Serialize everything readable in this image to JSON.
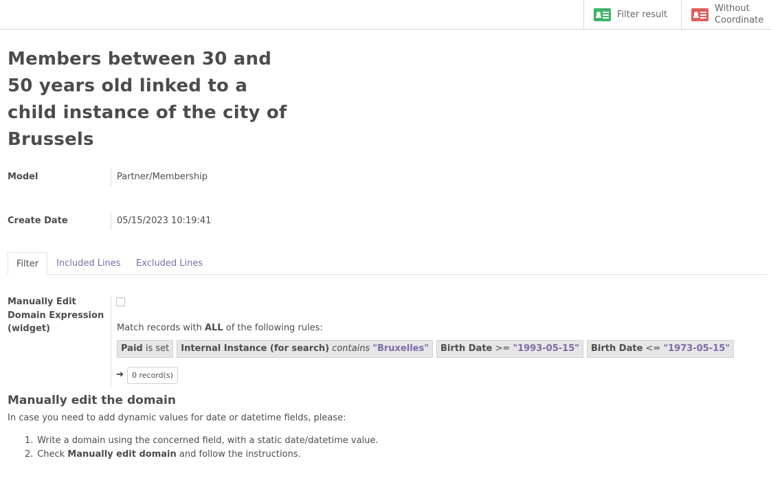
{
  "buttons": {
    "filter_result": "Filter result",
    "without_coordinate": "Without Coordinate"
  },
  "title": "Members between 30 and 50 years old linked to a child instance of the city of Brussels",
  "fields": {
    "model_label": "Model",
    "model_value": "Partner/Membership",
    "create_date_label": "Create Date",
    "create_date_value": "05/15/2023 10:19:41"
  },
  "tabs": [
    {
      "label": "Filter",
      "active": true
    },
    {
      "label": "Included Lines",
      "active": false
    },
    {
      "label": "Excluded Lines",
      "active": false
    }
  ],
  "domain": {
    "label": "Manually Edit Domain Expression (widget)",
    "checked": false,
    "match_prefix": "Match records with",
    "match_keyword": "ALL",
    "match_suffix": "of the following rules:",
    "rules": [
      {
        "field": "Paid",
        "operator": "is set",
        "value": ""
      },
      {
        "field": "Internal Instance (for search)",
        "operator": "contains",
        "value": "\"Bruxelles\""
      },
      {
        "field": "Birth Date",
        "operator": ">=",
        "value": "\"1993-05-15\""
      },
      {
        "field": "Birth Date",
        "operator": "<=",
        "value": "\"1973-05-15\""
      }
    ],
    "records": "0 record(s)"
  },
  "help": {
    "title": "Manually edit the domain",
    "text": "In case you need to add dynamic values for date or datetime fields, please:",
    "steps": [
      {
        "num": "1.",
        "text": "Write a domain using the concerned field, with a static date/datetime value."
      },
      {
        "num": "2.",
        "pre": "Check",
        "bold": "Manually edit domain",
        "post": "and follow the instructions."
      }
    ]
  },
  "colors": {
    "accent_purple": "#7c6ca8",
    "filter_icon": "#3fb36b",
    "without_icon": "#e05d5d"
  },
  "icons": {
    "filter_result": "id-card-icon",
    "without_coordinate": "id-card-icon",
    "records_arrow": "arrow-right-icon"
  }
}
